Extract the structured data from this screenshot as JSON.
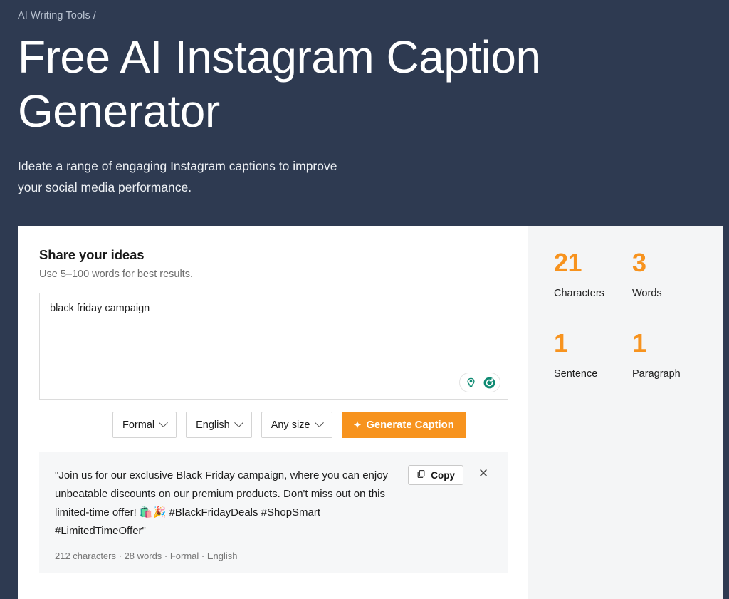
{
  "hero": {
    "breadcrumb": "AI Writing Tools /",
    "title": "Free AI Instagram Caption Generator",
    "subtitle": "Ideate a range of engaging Instagram captions to improve your social media performance."
  },
  "editor": {
    "heading": "Share your ideas",
    "hint": "Use 5–100 words for best results.",
    "input_value": "black friday campaign",
    "input_placeholder": "Share your ideas",
    "tools": [
      {
        "icon": "lightbulb-icon",
        "glyph": "💡"
      },
      {
        "icon": "refresh-icon",
        "glyph": "↻"
      }
    ]
  },
  "controls": {
    "tone": {
      "label": "Formal",
      "icon": "chevron-down-icon"
    },
    "language": {
      "label": "English",
      "icon": "chevron-down-icon"
    },
    "size": {
      "label": "Any size",
      "icon": "chevron-down-icon"
    },
    "generate": {
      "label": "Generate Caption",
      "icon": "sparkle-icon",
      "glyph": "✦",
      "color": "#f7931e"
    }
  },
  "result": {
    "text": "\"Join us for our exclusive Black Friday campaign, where you can enjoy unbeatable discounts on our premium products. Don't miss out on this limited-time offer! 🛍️🎉 #BlackFridayDeals #ShopSmart #LimitedTimeOffer\"",
    "meta": "212 characters · 28 words · Formal · English",
    "copy_label": "Copy",
    "copy_icon": "copy-icon",
    "close_icon": "close-icon",
    "close_glyph": "✕"
  },
  "stats": [
    {
      "value": "21",
      "label": "Characters"
    },
    {
      "value": "3",
      "label": "Words"
    },
    {
      "value": "1",
      "label": "Sentence"
    },
    {
      "value": "1",
      "label": "Paragraph"
    }
  ],
  "theme": {
    "hero_bg": "#2e3a51",
    "accent": "#f7931e",
    "tool_icon": "#0e8a72",
    "panel_bg": "#f4f5f6"
  }
}
